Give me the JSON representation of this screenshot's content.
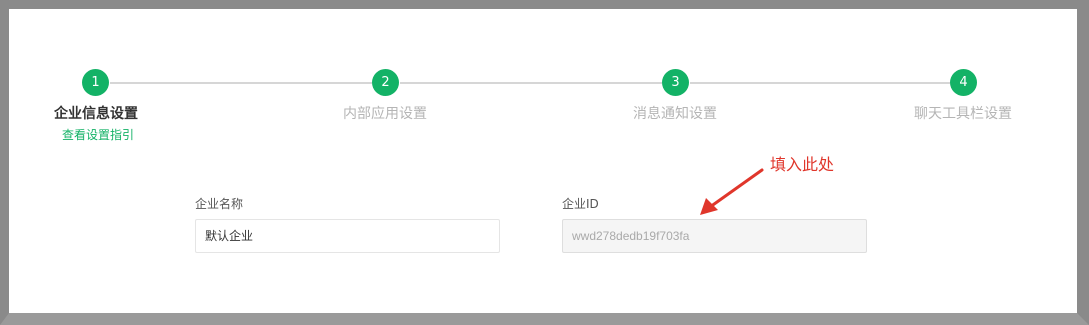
{
  "steps": [
    {
      "number": "1",
      "label": "企业信息设置",
      "active": true
    },
    {
      "number": "2",
      "label": "内部应用设置",
      "active": false
    },
    {
      "number": "3",
      "label": "消息通知设置",
      "active": false
    },
    {
      "number": "4",
      "label": "聊天工具栏设置",
      "active": false
    }
  ],
  "guide_link": "查看设置指引",
  "form": {
    "company_name_label": "企业名称",
    "company_name_value": "默认企业",
    "company_id_label": "企业ID",
    "company_id_value": "wwd278dedb19f703fa"
  },
  "annotation": {
    "text": "填入此处",
    "color": "#e0362b"
  },
  "colors": {
    "accent": "#13b266",
    "inactive_text": "#b5b5b5"
  }
}
